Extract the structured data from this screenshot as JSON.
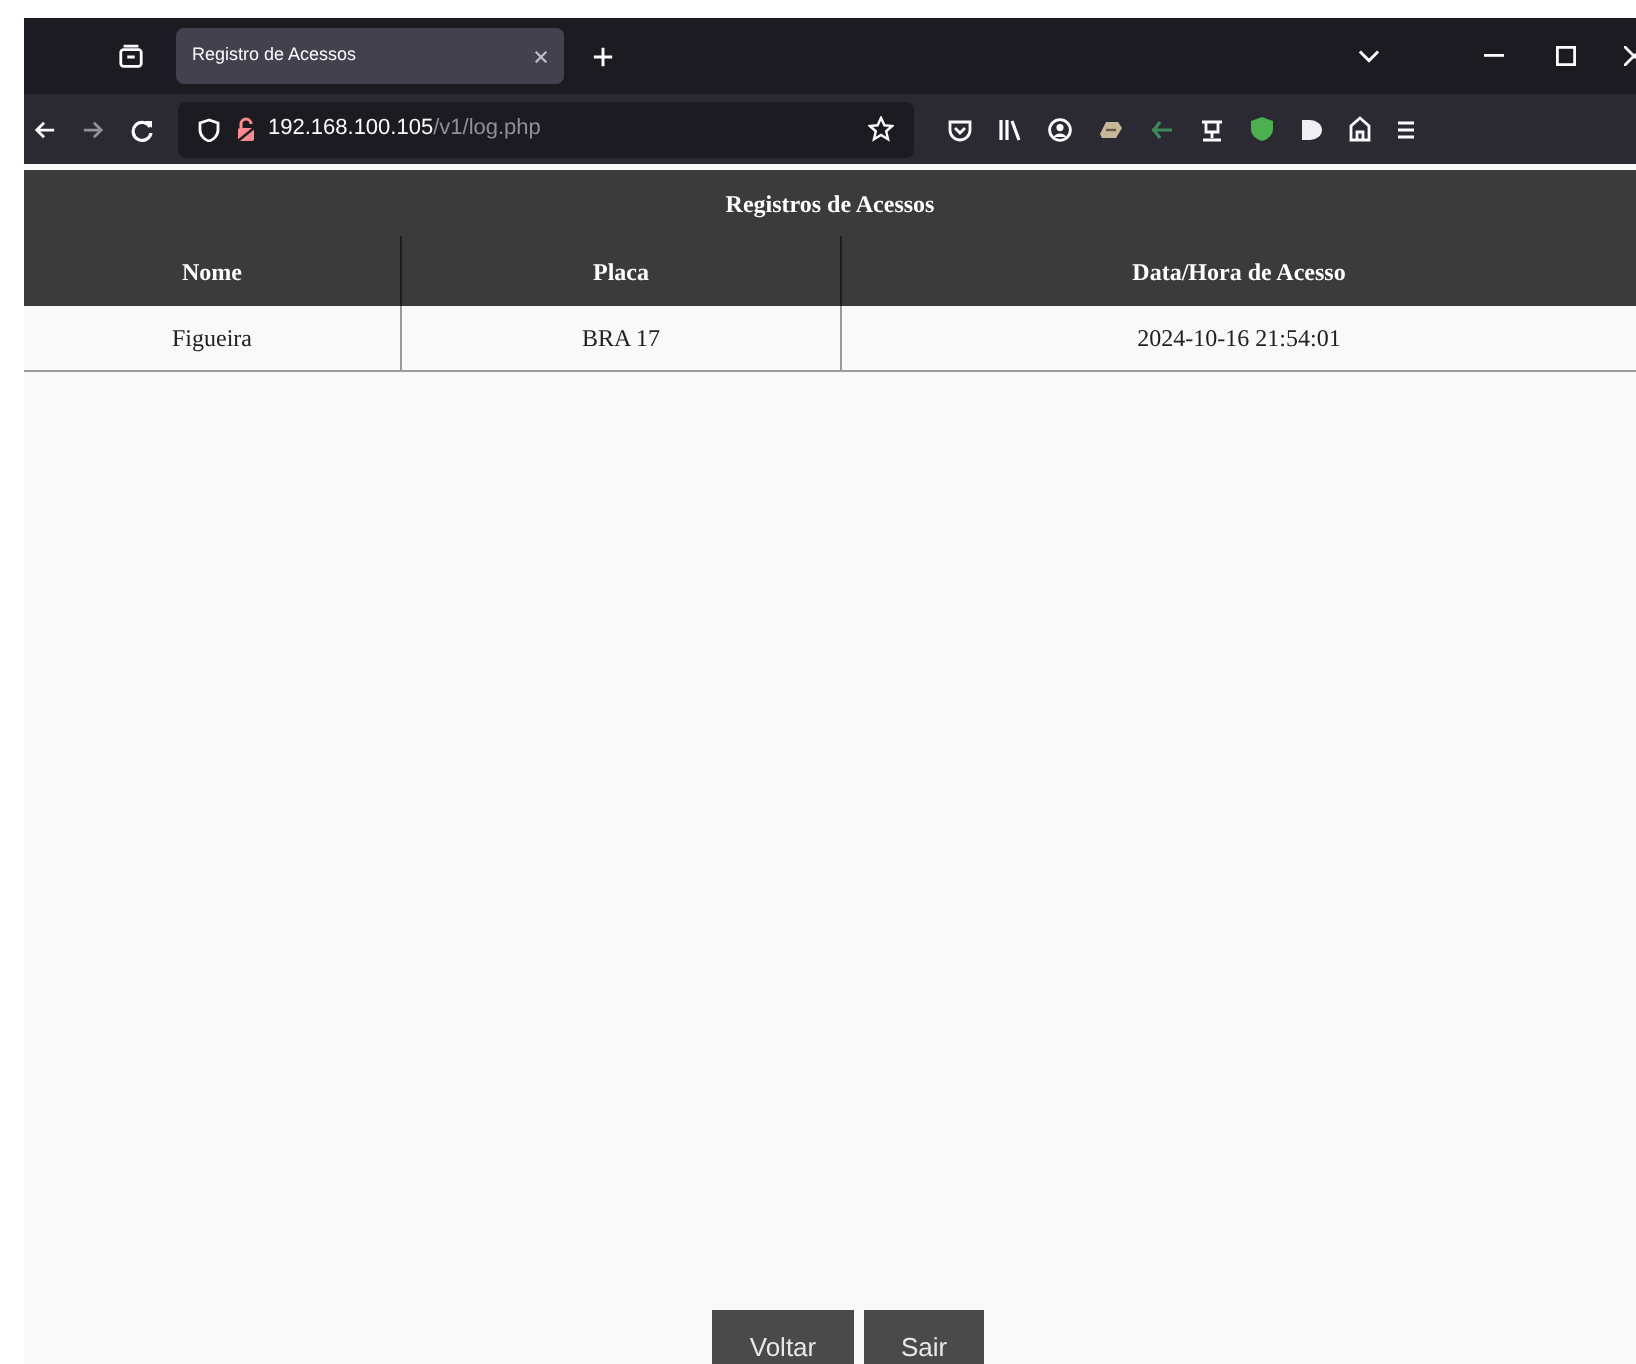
{
  "browser": {
    "tabs": [
      {
        "title": "Registro de Acessos",
        "selected": true
      }
    ],
    "url": {
      "host": "192.168.100.105",
      "path": "/v1/log.php"
    }
  },
  "table": {
    "title": "Registros de Acessos",
    "columns": [
      "Nome",
      "Placa",
      "Data/Hora de Acesso"
    ],
    "rows": [
      [
        "Figueira",
        "BRA 17",
        "2024-10-16 21:54:01"
      ]
    ]
  },
  "buttons": [
    "Voltar",
    "Sair"
  ]
}
